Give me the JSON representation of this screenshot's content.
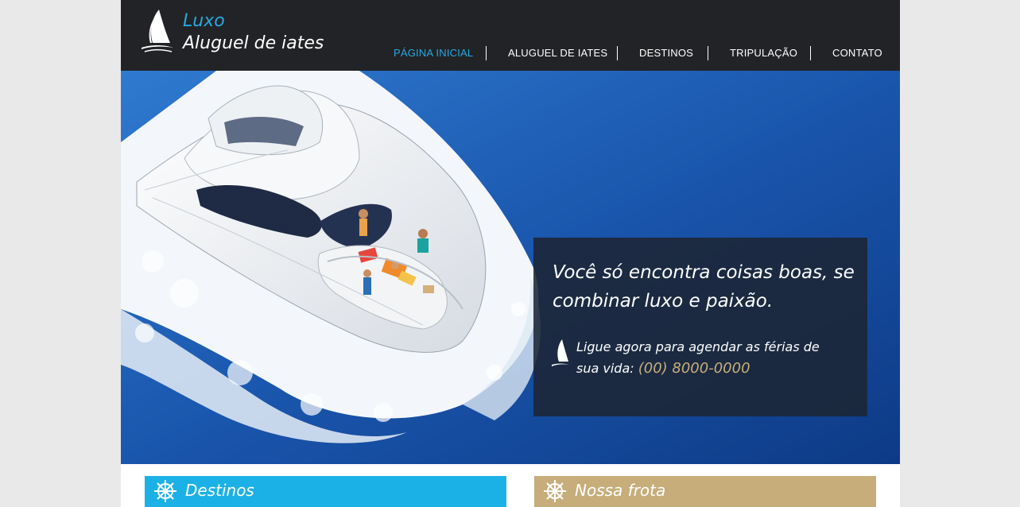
{
  "brand": {
    "line1": "Luxo",
    "line2": "Aluguel de iates",
    "icon": "sailboat-icon"
  },
  "nav": {
    "items": [
      {
        "label": "PÁGINA INICIAL",
        "active": true
      },
      {
        "label": "ALUGUEL DE IATES",
        "active": false
      },
      {
        "label": "DESTINOS",
        "active": false
      },
      {
        "label": "TRIPULAÇÃO",
        "active": false
      },
      {
        "label": "CONTATO",
        "active": false
      }
    ]
  },
  "hero": {
    "heading": "Você só encontra coisas boas, se combinar luxo e paixão.",
    "call_text": "Ligue agora para agendar as férias de sua vida:",
    "phone": "(00) 8000-0000"
  },
  "sections": [
    {
      "title": "Destinos",
      "icon": "ship-wheel-icon"
    },
    {
      "title": "Nossa frota",
      "icon": "ship-wheel-icon"
    }
  ],
  "colors": {
    "accent_blue": "#27a9e1",
    "header_bg": "#212326",
    "gold": "#c6ad7a",
    "phone_gold": "#c8ae7a"
  }
}
